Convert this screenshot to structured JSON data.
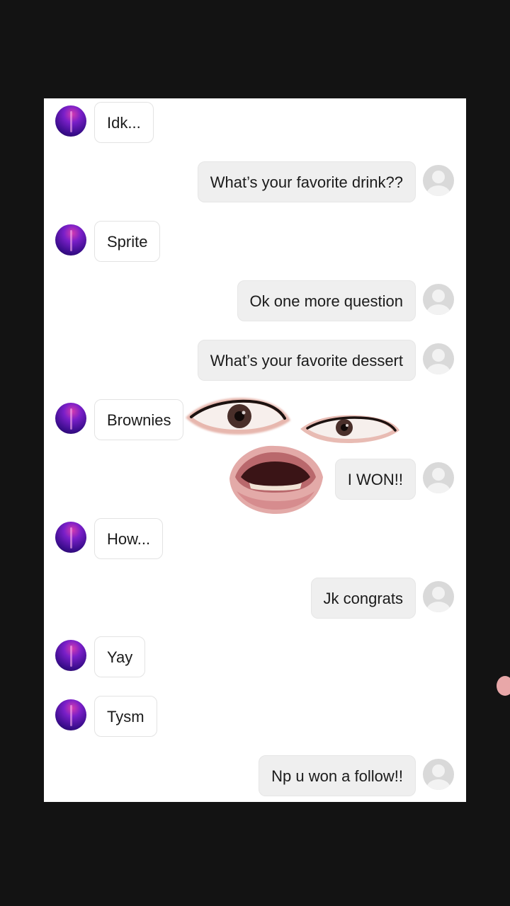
{
  "messages": [
    {
      "sender": "them",
      "text": "Idk..."
    },
    {
      "sender": "me",
      "text": "What’s your favorite drink??"
    },
    {
      "sender": "them",
      "text": "Sprite"
    },
    {
      "sender": "me",
      "text": "Ok one more question"
    },
    {
      "sender": "me",
      "text": "What’s your favorite dessert"
    },
    {
      "sender": "them",
      "text": "Brownies"
    },
    {
      "sender": "me",
      "text": "I WON!!"
    },
    {
      "sender": "them",
      "text": "How..."
    },
    {
      "sender": "me",
      "text": "Jk congrats"
    },
    {
      "sender": "them",
      "text": "Yay"
    },
    {
      "sender": "them",
      "text": "Tysm"
    },
    {
      "sender": "me",
      "text": "Np u won a follow!!"
    }
  ],
  "stickers": [
    "eye-sticker-left",
    "eye-sticker-right",
    "mouth-sticker"
  ],
  "colors": {
    "background": "#131313",
    "panel": "#ffffff",
    "my_bubble": "#efefef",
    "their_bubble": "#ffffff",
    "text": "#1b1b1b",
    "avatar_purple": "#7a1fc8"
  }
}
